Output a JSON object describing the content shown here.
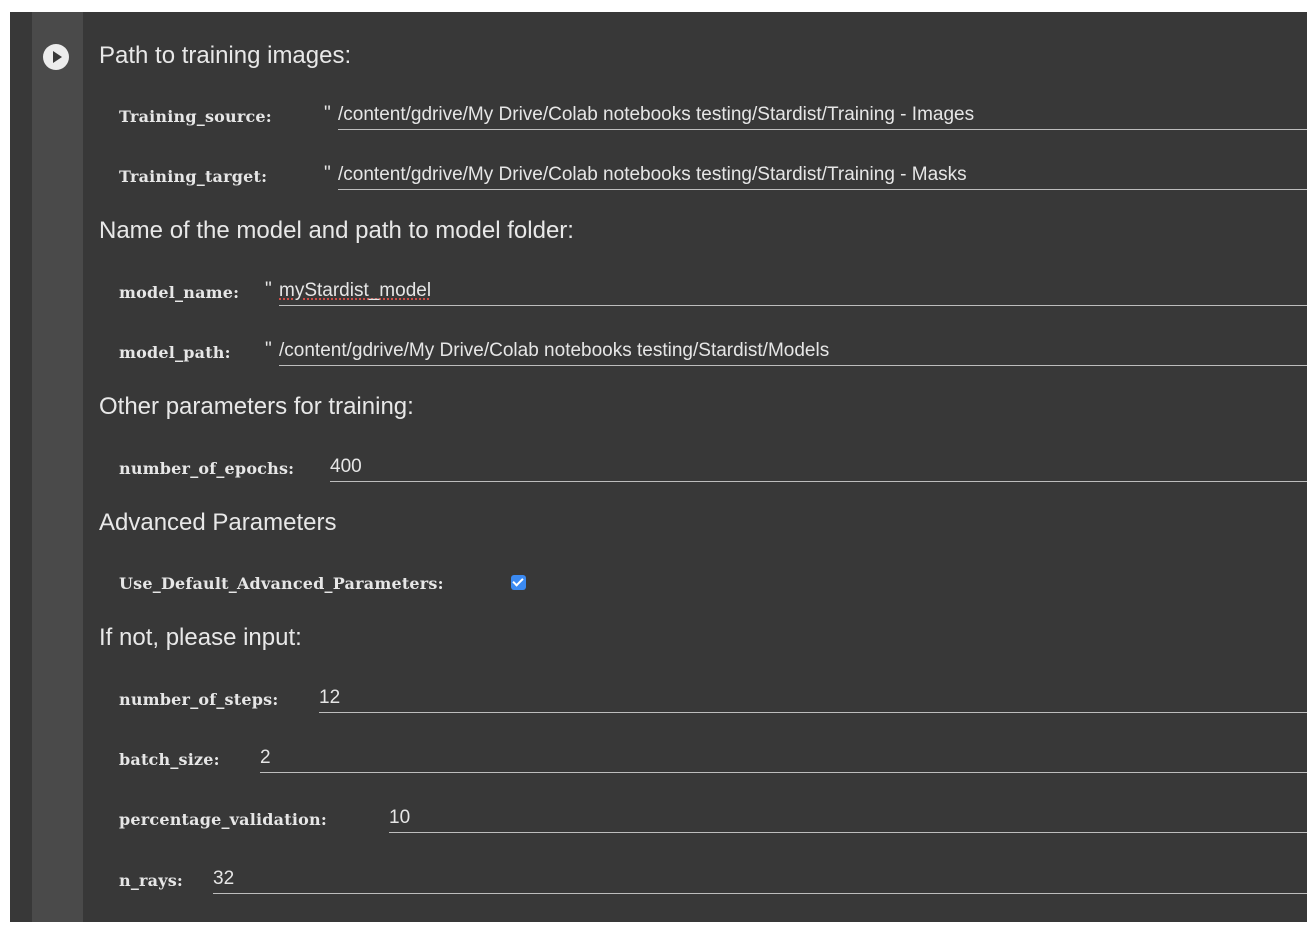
{
  "headings": {
    "training_paths": "Path to training images:",
    "model": "Name of the model and path to model folder:",
    "other_params": "Other parameters for training:",
    "advanced": "Advanced Parameters",
    "if_not": "If not, please input:"
  },
  "fields": {
    "training_source": {
      "label": "Training_source:",
      "quote": "\"",
      "value": "/content/gdrive/My Drive/Colab notebooks testing/Stardist/Training - Images"
    },
    "training_target": {
      "label": "Training_target:",
      "quote": "\"",
      "value": "/content/gdrive/My Drive/Colab notebooks testing/Stardist/Training - Masks"
    },
    "model_name": {
      "label": "model_name:",
      "quote": "\"",
      "value": "myStardist_model"
    },
    "model_path": {
      "label": "model_path:",
      "quote": "\"",
      "value": "/content/gdrive/My Drive/Colab notebooks testing/Stardist/Models"
    },
    "number_of_epochs": {
      "label": "number_of_epochs:",
      "value": "400"
    },
    "use_default_advanced": {
      "label": "Use_Default_Advanced_Parameters:",
      "checked": true
    },
    "number_of_steps": {
      "label": "number_of_steps:",
      "value": "12"
    },
    "batch_size": {
      "label": "batch_size:",
      "value": "2"
    },
    "percentage_validation": {
      "label": "percentage_validation:",
      "value": "10"
    },
    "n_rays": {
      "label": "n_rays:",
      "value": "32"
    }
  },
  "icons": {
    "run": "play-circle-icon",
    "checkbox_check": "checkmark-icon"
  },
  "colors": {
    "cell_background": "#383838",
    "gutter_background": "#4a4a4a",
    "checkbox_accent": "#3b8af2",
    "text": "#e6e6e6"
  }
}
